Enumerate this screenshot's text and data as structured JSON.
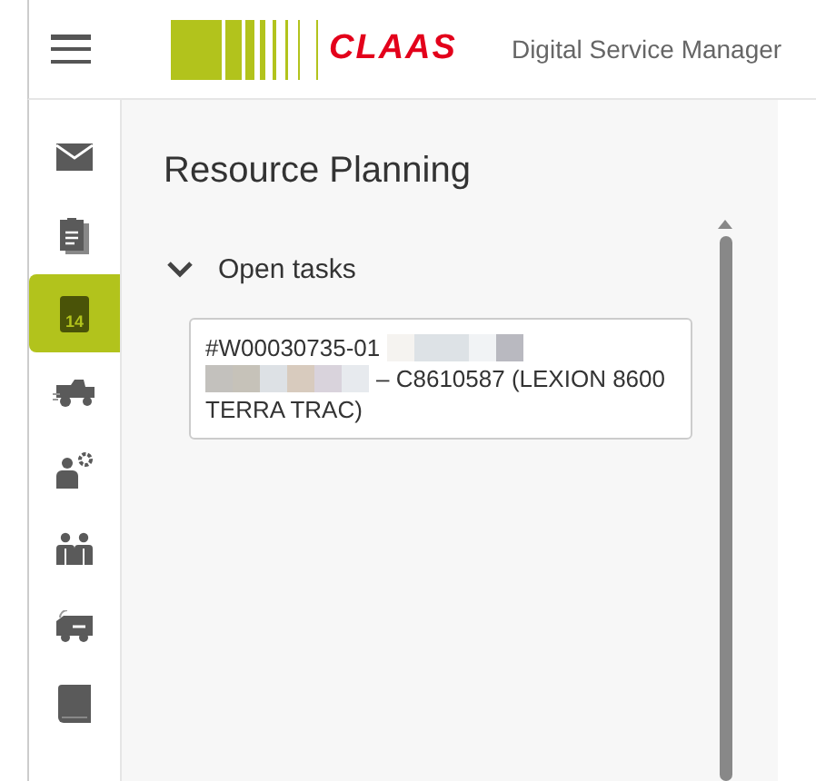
{
  "header": {
    "logo_text": "CLAAS",
    "app_title": "Digital Service Manager"
  },
  "sidebar": {
    "items": [
      {
        "kind": "mail",
        "selected": false
      },
      {
        "kind": "clipboard",
        "selected": false
      },
      {
        "kind": "calendar",
        "selected": true,
        "badge": "14"
      },
      {
        "kind": "harvester",
        "selected": false
      },
      {
        "kind": "person-gear",
        "selected": false
      },
      {
        "kind": "people",
        "selected": false
      },
      {
        "kind": "van",
        "selected": false
      },
      {
        "kind": "book",
        "selected": false
      }
    ]
  },
  "page": {
    "title": "Resource Planning",
    "section": {
      "label": "Open tasks",
      "expanded": true,
      "tasks": [
        {
          "id": "#W00030735-01",
          "detail_lines": [
            "– C8610587 (LEXION 8600",
            "TERRA TRAC)"
          ]
        }
      ]
    }
  }
}
